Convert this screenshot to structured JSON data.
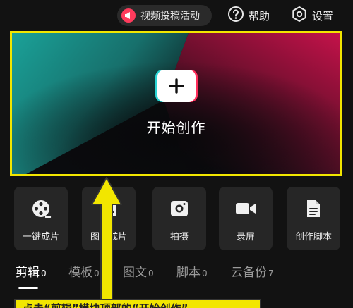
{
  "topbar": {
    "promo_label": "视频投稿活动",
    "help_label": "帮助",
    "settings_label": "设置"
  },
  "hero": {
    "title": "开始创作",
    "plus_icon": "plus-icon"
  },
  "tools": [
    {
      "label": "一键成片",
      "icon": "film-reel-icon"
    },
    {
      "label": "图文成片",
      "icon": "image-text-icon"
    },
    {
      "label": "拍摄",
      "icon": "camera-icon"
    },
    {
      "label": "录屏",
      "icon": "video-record-icon"
    },
    {
      "label": "创作脚本",
      "icon": "document-icon"
    }
  ],
  "tabs": [
    {
      "name": "剪辑",
      "count": "0",
      "active": true
    },
    {
      "name": "模板",
      "count": "0",
      "active": false
    },
    {
      "name": "图文",
      "count": "0",
      "active": false
    },
    {
      "name": "脚本",
      "count": "0",
      "active": false
    },
    {
      "name": "云备份",
      "count": "7",
      "active": false
    }
  ],
  "annotation": {
    "caption": "点击“剪辑”模块顶部的“开始创作”",
    "highlight_color": "#f2e600"
  },
  "colors": {
    "background": "#121212",
    "card": "#262626",
    "accent_red": "#ff3b5c",
    "accent_cyan": "#2ad4d4"
  }
}
